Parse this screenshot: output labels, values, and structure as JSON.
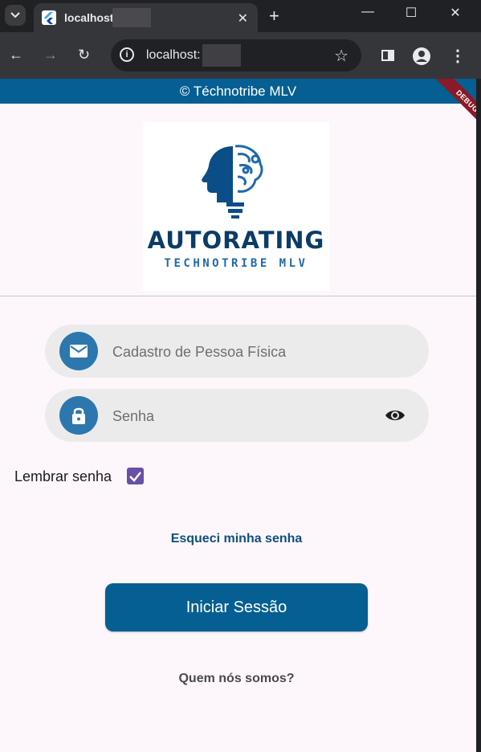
{
  "browser": {
    "tab_title": "localhost:",
    "url": "localhost:"
  },
  "app": {
    "header_title": "© Téchnotribe MLV",
    "debug_banner": "DEBUG",
    "logo_title": "AUTORATING",
    "logo_subtitle": "TECHNOTRIBE MLV"
  },
  "login": {
    "cpf_placeholder": "Cadastro de Pessoa Física",
    "password_placeholder": "Senha",
    "remember_label": "Lembrar senha",
    "remember_checked": true,
    "forgot_link": "Esqueci minha senha",
    "submit_label": "Iniciar Sessão",
    "about_link": "Quem nós somos?"
  },
  "colors": {
    "primary": "#055f92",
    "icon_circle": "#2c77ae",
    "checkbox": "#6850a6",
    "background": "#fdf7fc"
  }
}
